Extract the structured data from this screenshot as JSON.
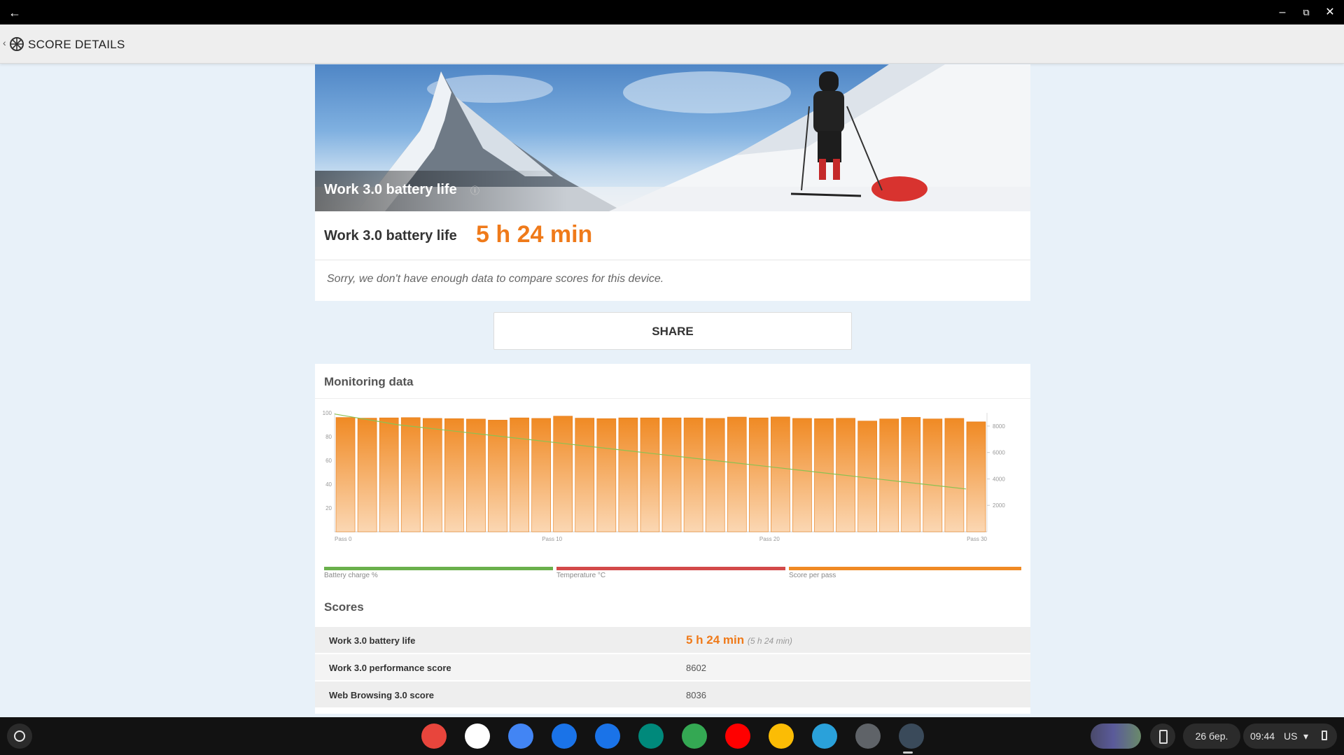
{
  "window": {
    "back_icon": "arrow-left-icon",
    "controls": [
      "minimize-icon",
      "restore-icon",
      "close-icon"
    ]
  },
  "header": {
    "title": "SCORE DETAILS",
    "icon": "pcmark-logo-icon"
  },
  "hero": {
    "title": "Work 3.0 battery life",
    "info_icon": "info-icon"
  },
  "result": {
    "label": "Work 3.0 battery life",
    "value": "5 h 24 min",
    "note": "Sorry, we don't have enough data to compare scores for this device."
  },
  "share": {
    "label": "SHARE"
  },
  "monitoring": {
    "title": "Monitoring data",
    "legend": [
      {
        "label": "Battery charge %",
        "color": "#6ab04c"
      },
      {
        "label": "Temperature °C",
        "color": "#d34a4a"
      },
      {
        "label": "Score per pass",
        "color": "#f08a24"
      }
    ]
  },
  "chart_data": {
    "type": "bar",
    "categories": [
      "Pass 0",
      "",
      "",
      "",
      "",
      "",
      "",
      "",
      "",
      "",
      "Pass 10",
      "",
      "",
      "",
      "",
      "",
      "",
      "",
      "",
      "",
      "Pass 20",
      "",
      "",
      "",
      "",
      "",
      "",
      "",
      "",
      "",
      "Pass 30"
    ],
    "series": [
      {
        "name": "Score per pass",
        "axis": "right",
        "color": "#f08a24",
        "values": [
          8650,
          8600,
          8620,
          8640,
          8580,
          8560,
          8530,
          8450,
          8620,
          8580,
          8750,
          8600,
          8560,
          8620,
          8620,
          8620,
          8620,
          8580,
          8680,
          8620,
          8690,
          8580,
          8560,
          8590,
          8380,
          8540,
          8660,
          8540,
          8580,
          8320
        ]
      },
      {
        "name": "Battery charge %",
        "axis": "left",
        "color": "#8cc152",
        "values": [
          99,
          96,
          93,
          90,
          88,
          86,
          84,
          82,
          80,
          78,
          76,
          74,
          72,
          70,
          68,
          66,
          64,
          62,
          60,
          58,
          56,
          54,
          52,
          50,
          48,
          46,
          44,
          42,
          40,
          38,
          36
        ]
      }
    ],
    "left_axis": {
      "ticks": [
        20,
        40,
        60,
        80,
        100
      ],
      "range": [
        0,
        100
      ]
    },
    "right_axis": {
      "ticks": [
        2000,
        4000,
        6000,
        8000
      ],
      "range": [
        0,
        9000
      ]
    },
    "x_tick_labels": [
      "Pass 0",
      "Pass 10",
      "Pass 20",
      "Pass 30"
    ]
  },
  "scores": {
    "title": "Scores",
    "rows": [
      {
        "label": "Work 3.0 battery life",
        "value": "5 h 24 min",
        "sub": "(5 h 24 min)"
      },
      {
        "label": "Work 3.0 performance score",
        "value": "8602"
      },
      {
        "label": "Web Browsing 3.0 score",
        "value": "8036"
      }
    ]
  },
  "shelf": {
    "apps": [
      {
        "name": "chrome-icon",
        "color": "#e8453c"
      },
      {
        "name": "gmail-icon",
        "color": "#ffffff"
      },
      {
        "name": "calendar-icon",
        "color": "#4285f4"
      },
      {
        "name": "files-icon",
        "color": "#1a73e8"
      },
      {
        "name": "messages-icon",
        "color": "#1a73e8"
      },
      {
        "name": "meet-icon",
        "color": "#00897b"
      },
      {
        "name": "play-store-icon",
        "color": "#34a853"
      },
      {
        "name": "youtube-icon",
        "color": "#ff0000"
      },
      {
        "name": "photos-icon",
        "color": "#fbbc05"
      },
      {
        "name": "telegram-icon",
        "color": "#2aa1da"
      },
      {
        "name": "settings-icon",
        "color": "#5f6368"
      },
      {
        "name": "pcmark-icon",
        "color": "#3a4a5a"
      }
    ],
    "date": "26 бер.",
    "time": "09:44",
    "lang": "US"
  }
}
